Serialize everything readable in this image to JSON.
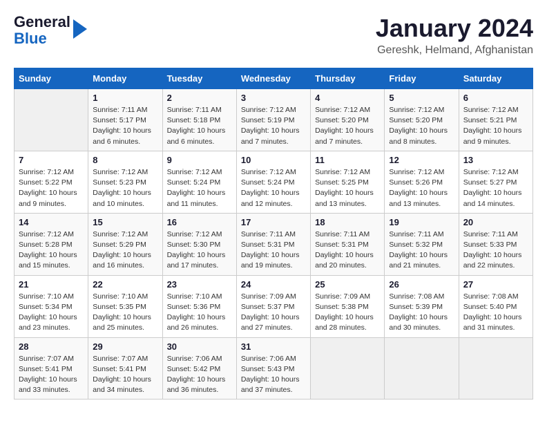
{
  "logo": {
    "line1": "General",
    "line2": "Blue"
  },
  "title": "January 2024",
  "location": "Gereshk, Helmand, Afghanistan",
  "weekdays": [
    "Sunday",
    "Monday",
    "Tuesday",
    "Wednesday",
    "Thursday",
    "Friday",
    "Saturday"
  ],
  "weeks": [
    [
      {
        "day": "",
        "info": ""
      },
      {
        "day": "1",
        "info": "Sunrise: 7:11 AM\nSunset: 5:17 PM\nDaylight: 10 hours\nand 6 minutes."
      },
      {
        "day": "2",
        "info": "Sunrise: 7:11 AM\nSunset: 5:18 PM\nDaylight: 10 hours\nand 6 minutes."
      },
      {
        "day": "3",
        "info": "Sunrise: 7:12 AM\nSunset: 5:19 PM\nDaylight: 10 hours\nand 7 minutes."
      },
      {
        "day": "4",
        "info": "Sunrise: 7:12 AM\nSunset: 5:20 PM\nDaylight: 10 hours\nand 7 minutes."
      },
      {
        "day": "5",
        "info": "Sunrise: 7:12 AM\nSunset: 5:20 PM\nDaylight: 10 hours\nand 8 minutes."
      },
      {
        "day": "6",
        "info": "Sunrise: 7:12 AM\nSunset: 5:21 PM\nDaylight: 10 hours\nand 9 minutes."
      }
    ],
    [
      {
        "day": "7",
        "info": "Sunrise: 7:12 AM\nSunset: 5:22 PM\nDaylight: 10 hours\nand 9 minutes."
      },
      {
        "day": "8",
        "info": "Sunrise: 7:12 AM\nSunset: 5:23 PM\nDaylight: 10 hours\nand 10 minutes."
      },
      {
        "day": "9",
        "info": "Sunrise: 7:12 AM\nSunset: 5:24 PM\nDaylight: 10 hours\nand 11 minutes."
      },
      {
        "day": "10",
        "info": "Sunrise: 7:12 AM\nSunset: 5:24 PM\nDaylight: 10 hours\nand 12 minutes."
      },
      {
        "day": "11",
        "info": "Sunrise: 7:12 AM\nSunset: 5:25 PM\nDaylight: 10 hours\nand 13 minutes."
      },
      {
        "day": "12",
        "info": "Sunrise: 7:12 AM\nSunset: 5:26 PM\nDaylight: 10 hours\nand 13 minutes."
      },
      {
        "day": "13",
        "info": "Sunrise: 7:12 AM\nSunset: 5:27 PM\nDaylight: 10 hours\nand 14 minutes."
      }
    ],
    [
      {
        "day": "14",
        "info": "Sunrise: 7:12 AM\nSunset: 5:28 PM\nDaylight: 10 hours\nand 15 minutes."
      },
      {
        "day": "15",
        "info": "Sunrise: 7:12 AM\nSunset: 5:29 PM\nDaylight: 10 hours\nand 16 minutes."
      },
      {
        "day": "16",
        "info": "Sunrise: 7:12 AM\nSunset: 5:30 PM\nDaylight: 10 hours\nand 17 minutes."
      },
      {
        "day": "17",
        "info": "Sunrise: 7:11 AM\nSunset: 5:31 PM\nDaylight: 10 hours\nand 19 minutes."
      },
      {
        "day": "18",
        "info": "Sunrise: 7:11 AM\nSunset: 5:31 PM\nDaylight: 10 hours\nand 20 minutes."
      },
      {
        "day": "19",
        "info": "Sunrise: 7:11 AM\nSunset: 5:32 PM\nDaylight: 10 hours\nand 21 minutes."
      },
      {
        "day": "20",
        "info": "Sunrise: 7:11 AM\nSunset: 5:33 PM\nDaylight: 10 hours\nand 22 minutes."
      }
    ],
    [
      {
        "day": "21",
        "info": "Sunrise: 7:10 AM\nSunset: 5:34 PM\nDaylight: 10 hours\nand 23 minutes."
      },
      {
        "day": "22",
        "info": "Sunrise: 7:10 AM\nSunset: 5:35 PM\nDaylight: 10 hours\nand 25 minutes."
      },
      {
        "day": "23",
        "info": "Sunrise: 7:10 AM\nSunset: 5:36 PM\nDaylight: 10 hours\nand 26 minutes."
      },
      {
        "day": "24",
        "info": "Sunrise: 7:09 AM\nSunset: 5:37 PM\nDaylight: 10 hours\nand 27 minutes."
      },
      {
        "day": "25",
        "info": "Sunrise: 7:09 AM\nSunset: 5:38 PM\nDaylight: 10 hours\nand 28 minutes."
      },
      {
        "day": "26",
        "info": "Sunrise: 7:08 AM\nSunset: 5:39 PM\nDaylight: 10 hours\nand 30 minutes."
      },
      {
        "day": "27",
        "info": "Sunrise: 7:08 AM\nSunset: 5:40 PM\nDaylight: 10 hours\nand 31 minutes."
      }
    ],
    [
      {
        "day": "28",
        "info": "Sunrise: 7:07 AM\nSunset: 5:41 PM\nDaylight: 10 hours\nand 33 minutes."
      },
      {
        "day": "29",
        "info": "Sunrise: 7:07 AM\nSunset: 5:41 PM\nDaylight: 10 hours\nand 34 minutes."
      },
      {
        "day": "30",
        "info": "Sunrise: 7:06 AM\nSunset: 5:42 PM\nDaylight: 10 hours\nand 36 minutes."
      },
      {
        "day": "31",
        "info": "Sunrise: 7:06 AM\nSunset: 5:43 PM\nDaylight: 10 hours\nand 37 minutes."
      },
      {
        "day": "",
        "info": ""
      },
      {
        "day": "",
        "info": ""
      },
      {
        "day": "",
        "info": ""
      }
    ]
  ]
}
